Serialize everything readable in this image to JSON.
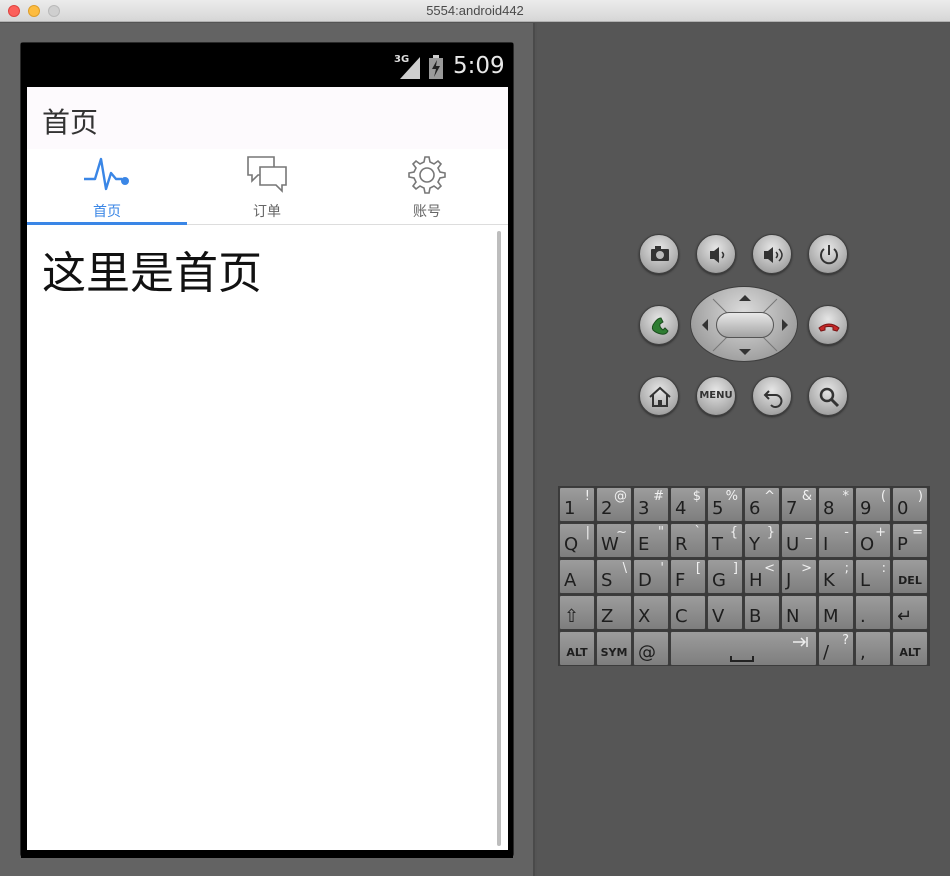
{
  "window": {
    "title": "5554:android442"
  },
  "status_bar": {
    "network": "3G",
    "time": "5:09"
  },
  "app_bar": {
    "title": "首页"
  },
  "tabs": [
    {
      "label": "首页",
      "icon": "pulse-icon",
      "active": true
    },
    {
      "label": "订单",
      "icon": "chat-bubbles-icon",
      "active": false
    },
    {
      "label": "账号",
      "icon": "gear-icon",
      "active": false
    }
  ],
  "content": {
    "text": "这里是首页"
  },
  "colors": {
    "accent": "#3a86e6",
    "emulator_bg": "#565656",
    "device": "#000000"
  },
  "hardware_buttons": {
    "menu_label": "MENU"
  },
  "keyboard": {
    "row1": [
      {
        "main": "1",
        "alt": "!"
      },
      {
        "main": "2",
        "alt": "@"
      },
      {
        "main": "3",
        "alt": "#"
      },
      {
        "main": "4",
        "alt": "$"
      },
      {
        "main": "5",
        "alt": "%"
      },
      {
        "main": "6",
        "alt": "^"
      },
      {
        "main": "7",
        "alt": "&"
      },
      {
        "main": "8",
        "alt": "*"
      },
      {
        "main": "9",
        "alt": "("
      },
      {
        "main": "0",
        "alt": ")"
      }
    ],
    "row2": [
      {
        "main": "Q",
        "alt": "|"
      },
      {
        "main": "W",
        "alt": "~"
      },
      {
        "main": "E",
        "alt": "\""
      },
      {
        "main": "R",
        "alt": "`"
      },
      {
        "main": "T",
        "alt": "{"
      },
      {
        "main": "Y",
        "alt": "}"
      },
      {
        "main": "U",
        "alt": "_"
      },
      {
        "main": "I",
        "alt": "-"
      },
      {
        "main": "O",
        "alt": "+"
      },
      {
        "main": "P",
        "alt": "="
      }
    ],
    "row3": [
      {
        "main": "A",
        "alt": ""
      },
      {
        "main": "S",
        "alt": "\\"
      },
      {
        "main": "D",
        "alt": "'"
      },
      {
        "main": "F",
        "alt": "["
      },
      {
        "main": "G",
        "alt": "]"
      },
      {
        "main": "H",
        "alt": "<"
      },
      {
        "main": "J",
        "alt": ">"
      },
      {
        "main": "K",
        "alt": ";"
      },
      {
        "main": "L",
        "alt": ":"
      },
      {
        "main": "DEL",
        "alt": ""
      }
    ],
    "row4": [
      {
        "main": "⇧",
        "alt": ""
      },
      {
        "main": "Z",
        "alt": ""
      },
      {
        "main": "X",
        "alt": ""
      },
      {
        "main": "C",
        "alt": ""
      },
      {
        "main": "V",
        "alt": ""
      },
      {
        "main": "B",
        "alt": ""
      },
      {
        "main": "N",
        "alt": ""
      },
      {
        "main": "M",
        "alt": ""
      },
      {
        "main": ".",
        "alt": ""
      },
      {
        "main": "↵",
        "alt": ""
      }
    ],
    "row5_left": [
      {
        "main": "ALT"
      },
      {
        "main": "SYM"
      },
      {
        "main": "@"
      }
    ],
    "row5_right": [
      {
        "main": "/",
        "alt": "?"
      },
      {
        "main": ",",
        "alt": ""
      },
      {
        "main": "ALT"
      }
    ]
  }
}
